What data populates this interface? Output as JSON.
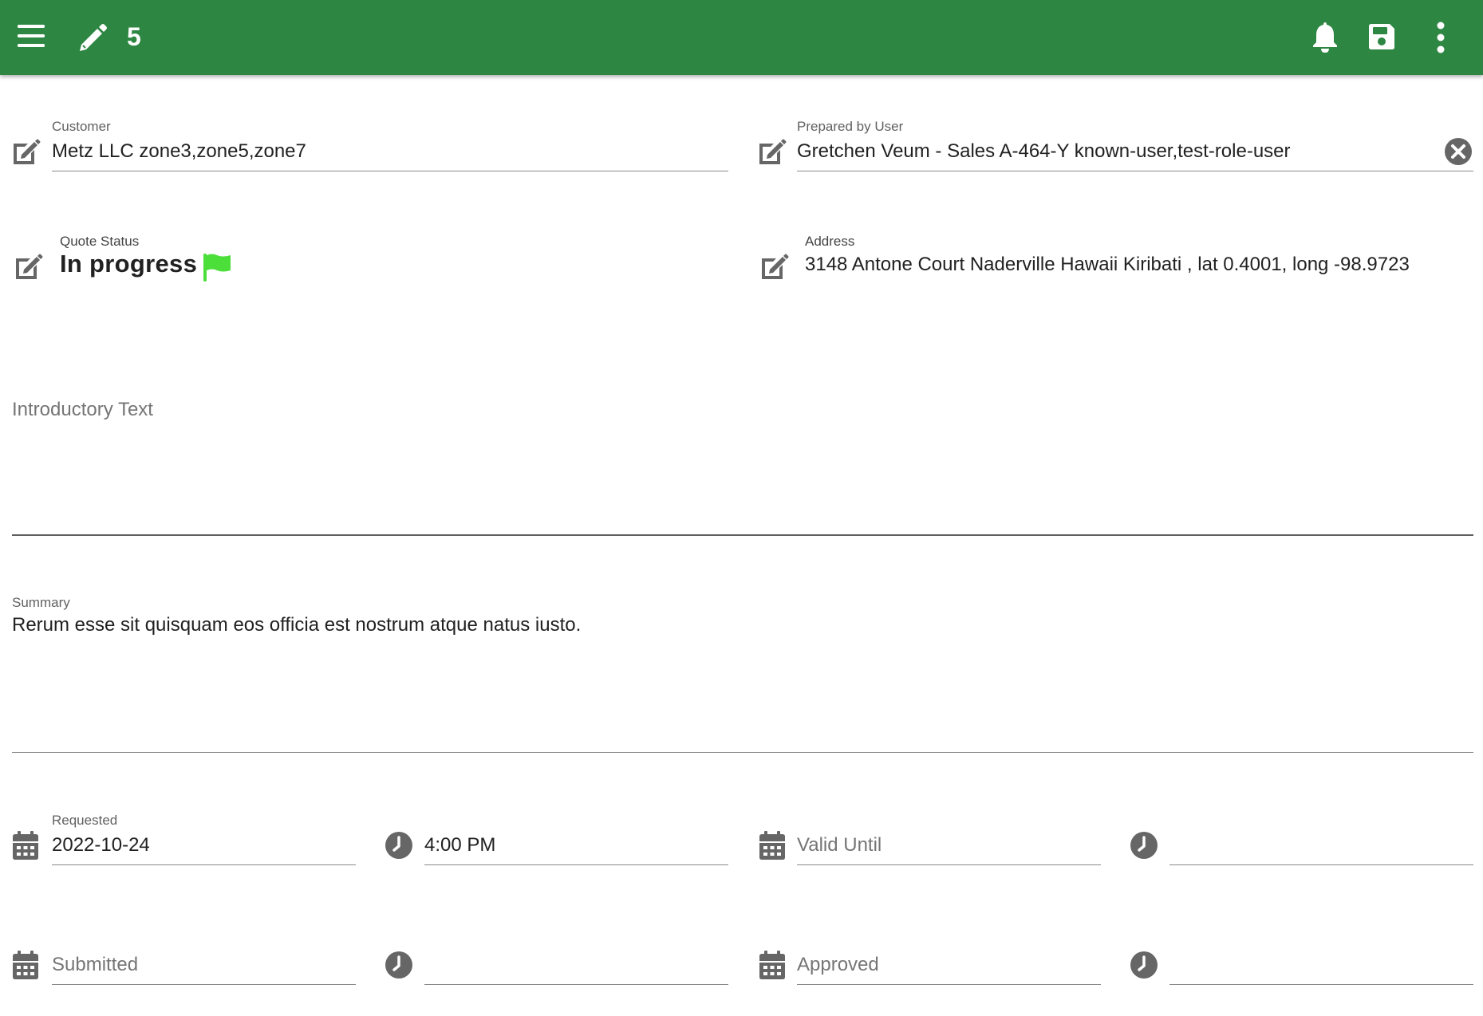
{
  "appbar": {
    "title": "5",
    "icons": [
      "menu-icon",
      "pencil-icon",
      "bell-icon",
      "save-icon",
      "more-vert-icon"
    ],
    "color": "#2d8642"
  },
  "customer": {
    "label": "Customer",
    "value": "Metz LLC zone3,zone5,zone7"
  },
  "prepared_by": {
    "label": "Prepared by User",
    "value": "Gretchen Veum - Sales A-464-Y known-user,test-role-user"
  },
  "quote_status": {
    "label": "Quote Status",
    "value": "In progress",
    "flag_color": "#4cdf3a"
  },
  "address": {
    "label": "Address",
    "value": "3148 Antone Court Naderville Hawaii Kiribati , lat 0.4001, long -98.9723"
  },
  "introductory_text": {
    "placeholder": "Introductory Text"
  },
  "summary": {
    "label": "Summary",
    "value": "Rerum esse sit quisquam eos officia est nostrum atque natus iusto."
  },
  "requested": {
    "label": "Requested",
    "date": "2022-10-24",
    "time": "4:00 PM"
  },
  "valid_until": {
    "placeholder": "Valid Until",
    "time": ""
  },
  "submitted": {
    "placeholder": "Submitted",
    "time": ""
  },
  "approved": {
    "placeholder": "Approved",
    "time": ""
  }
}
